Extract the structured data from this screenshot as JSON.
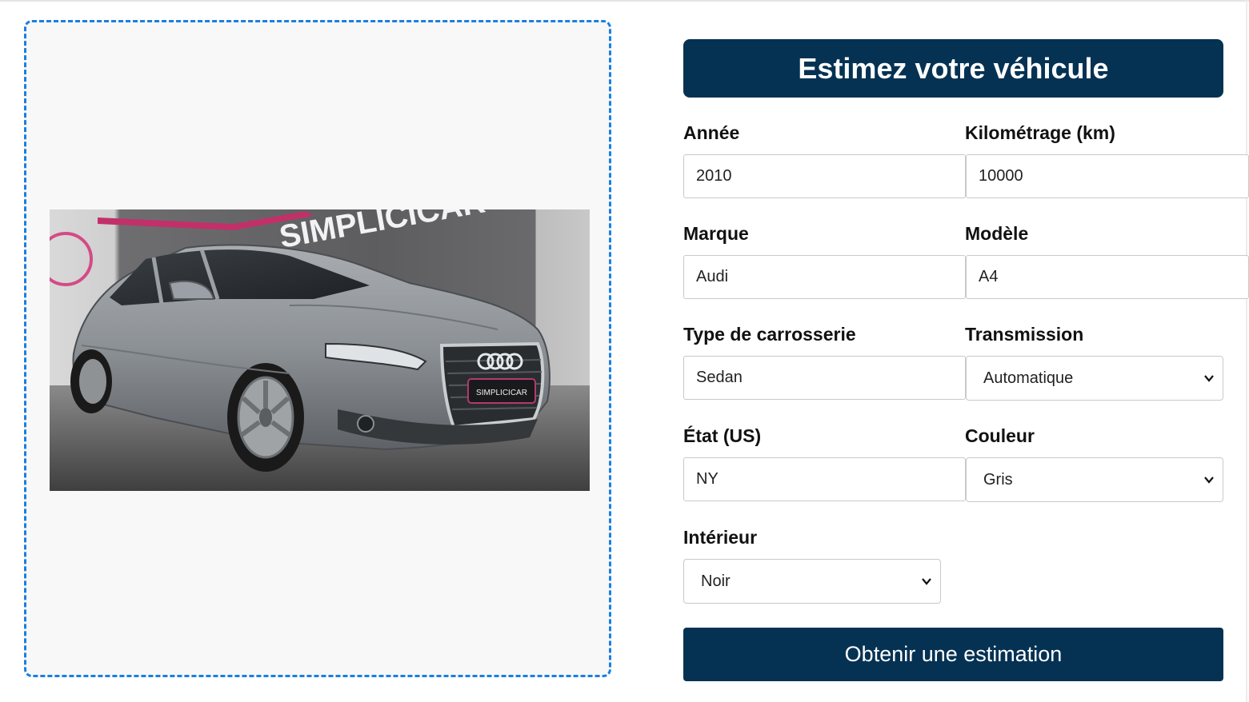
{
  "form": {
    "title": "Estimez votre véhicule",
    "fields": {
      "year": {
        "label": "Année",
        "value": "2010"
      },
      "mileage": {
        "label": "Kilométrage (km)",
        "value": "10000"
      },
      "make": {
        "label": "Marque",
        "value": "Audi"
      },
      "model": {
        "label": "Modèle",
        "value": "A4"
      },
      "body_type": {
        "label": "Type de carrosserie",
        "value": "Sedan"
      },
      "transmission": {
        "label": "Transmission",
        "selected": "Automatique"
      },
      "state": {
        "label": "État (US)",
        "value": "NY"
      },
      "color": {
        "label": "Couleur",
        "selected": "Gris"
      },
      "interior": {
        "label": "Intérieur",
        "selected": "Noir"
      }
    },
    "submit_label": "Obtenir une estimation"
  },
  "upload": {
    "image_alt": "Audi A4 grise devant un mur SIMPLICICAR",
    "wall_sign": "SIMPLICICAR",
    "plate_text": "SIMPLICICAR"
  },
  "colors": {
    "primary": "#053253",
    "dropzone_border": "#1a7fe0",
    "dropzone_bg": "#f8f8f8"
  }
}
